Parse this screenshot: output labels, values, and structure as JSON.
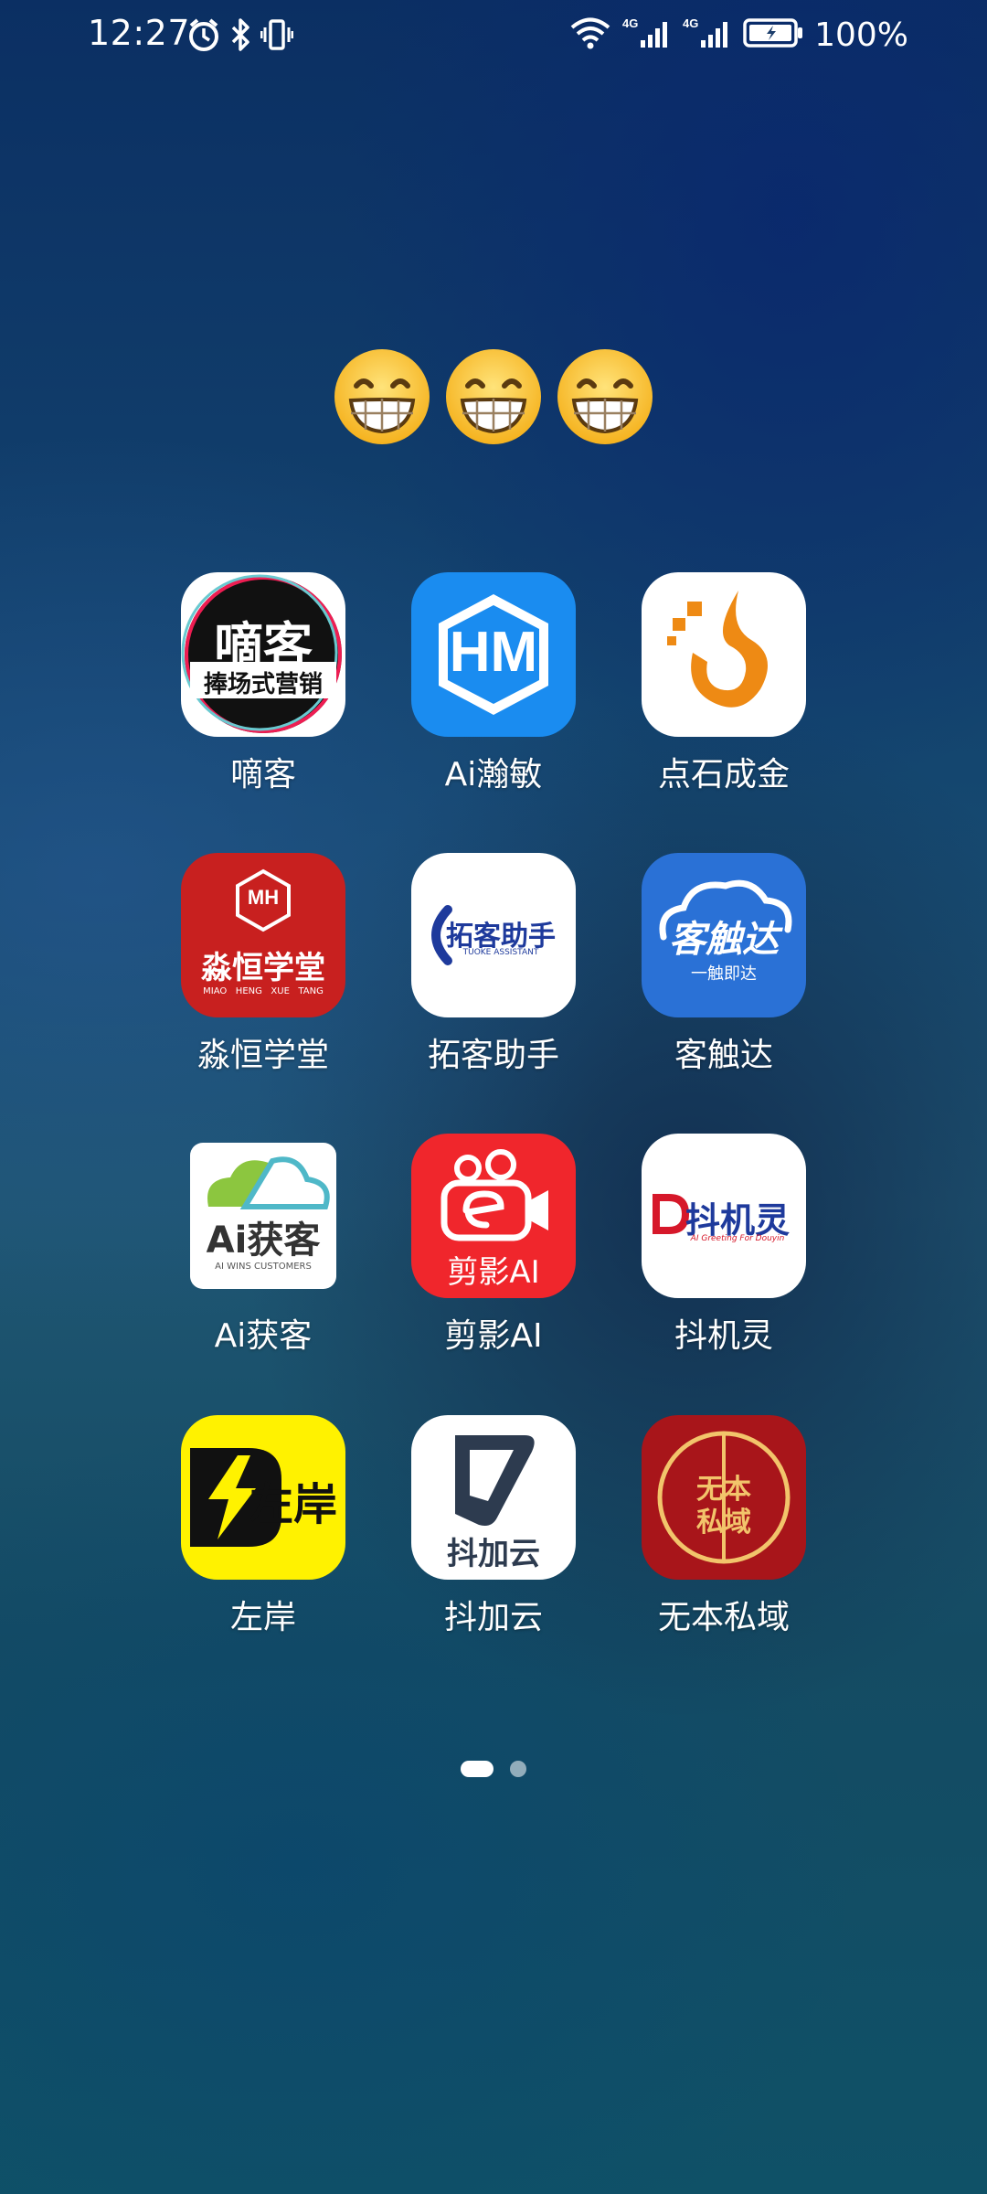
{
  "status_bar": {
    "time": "12:27",
    "battery": "100%",
    "network_label": "4G",
    "icons": [
      "alarm-icon",
      "bluetooth-icon",
      "vibrate-icon",
      "wifi-icon",
      "signal-icon",
      "battery-icon"
    ]
  },
  "emoji": [
    "😁",
    "😁",
    "😁"
  ],
  "apps": [
    {
      "label": "嘀客",
      "icon_text": "嘀客",
      "icon_sub": "捧场式营销"
    },
    {
      "label": "Ai瀚敏",
      "icon_text": "HM"
    },
    {
      "label": "点石成金"
    },
    {
      "label": "淼恒学堂",
      "icon_text": "淼恒学堂",
      "icon_sub": "MIAO   HENG   XUE   TANG",
      "icon_badge": "MH"
    },
    {
      "label": "拓客助手",
      "icon_text": "拓客助手",
      "icon_sub": "TUOKE ASSISTANT"
    },
    {
      "label": "客触达",
      "icon_text": "客触达",
      "icon_sub": "一触即达"
    },
    {
      "label": "Ai获客",
      "icon_text": "Ai获客",
      "icon_sub": "AI WINS CUSTOMERS"
    },
    {
      "label": "剪影AI",
      "icon_text": "剪影AI"
    },
    {
      "label": "抖机灵",
      "icon_text": "抖机灵",
      "icon_sub": "AI Greeting For Douyin"
    },
    {
      "label": "左岸",
      "icon_text": "左岸"
    },
    {
      "label": "抖加云",
      "icon_text": "抖加云"
    },
    {
      "label": "无本私域",
      "icon_text": "无本",
      "icon_text2": "私域"
    }
  ],
  "page_indicator": {
    "current": 1,
    "total": 2
  },
  "colors": {
    "hm_blue": "#1a8cf0",
    "gold": "#ee8a14",
    "brick_red": "#c8201f",
    "navy": "#1e3a9c",
    "kechuda_blue": "#2a71d6",
    "jianying_red": "#f0262c",
    "zuoan_yellow": "#fff200",
    "wuben_red": "#a8151a"
  }
}
